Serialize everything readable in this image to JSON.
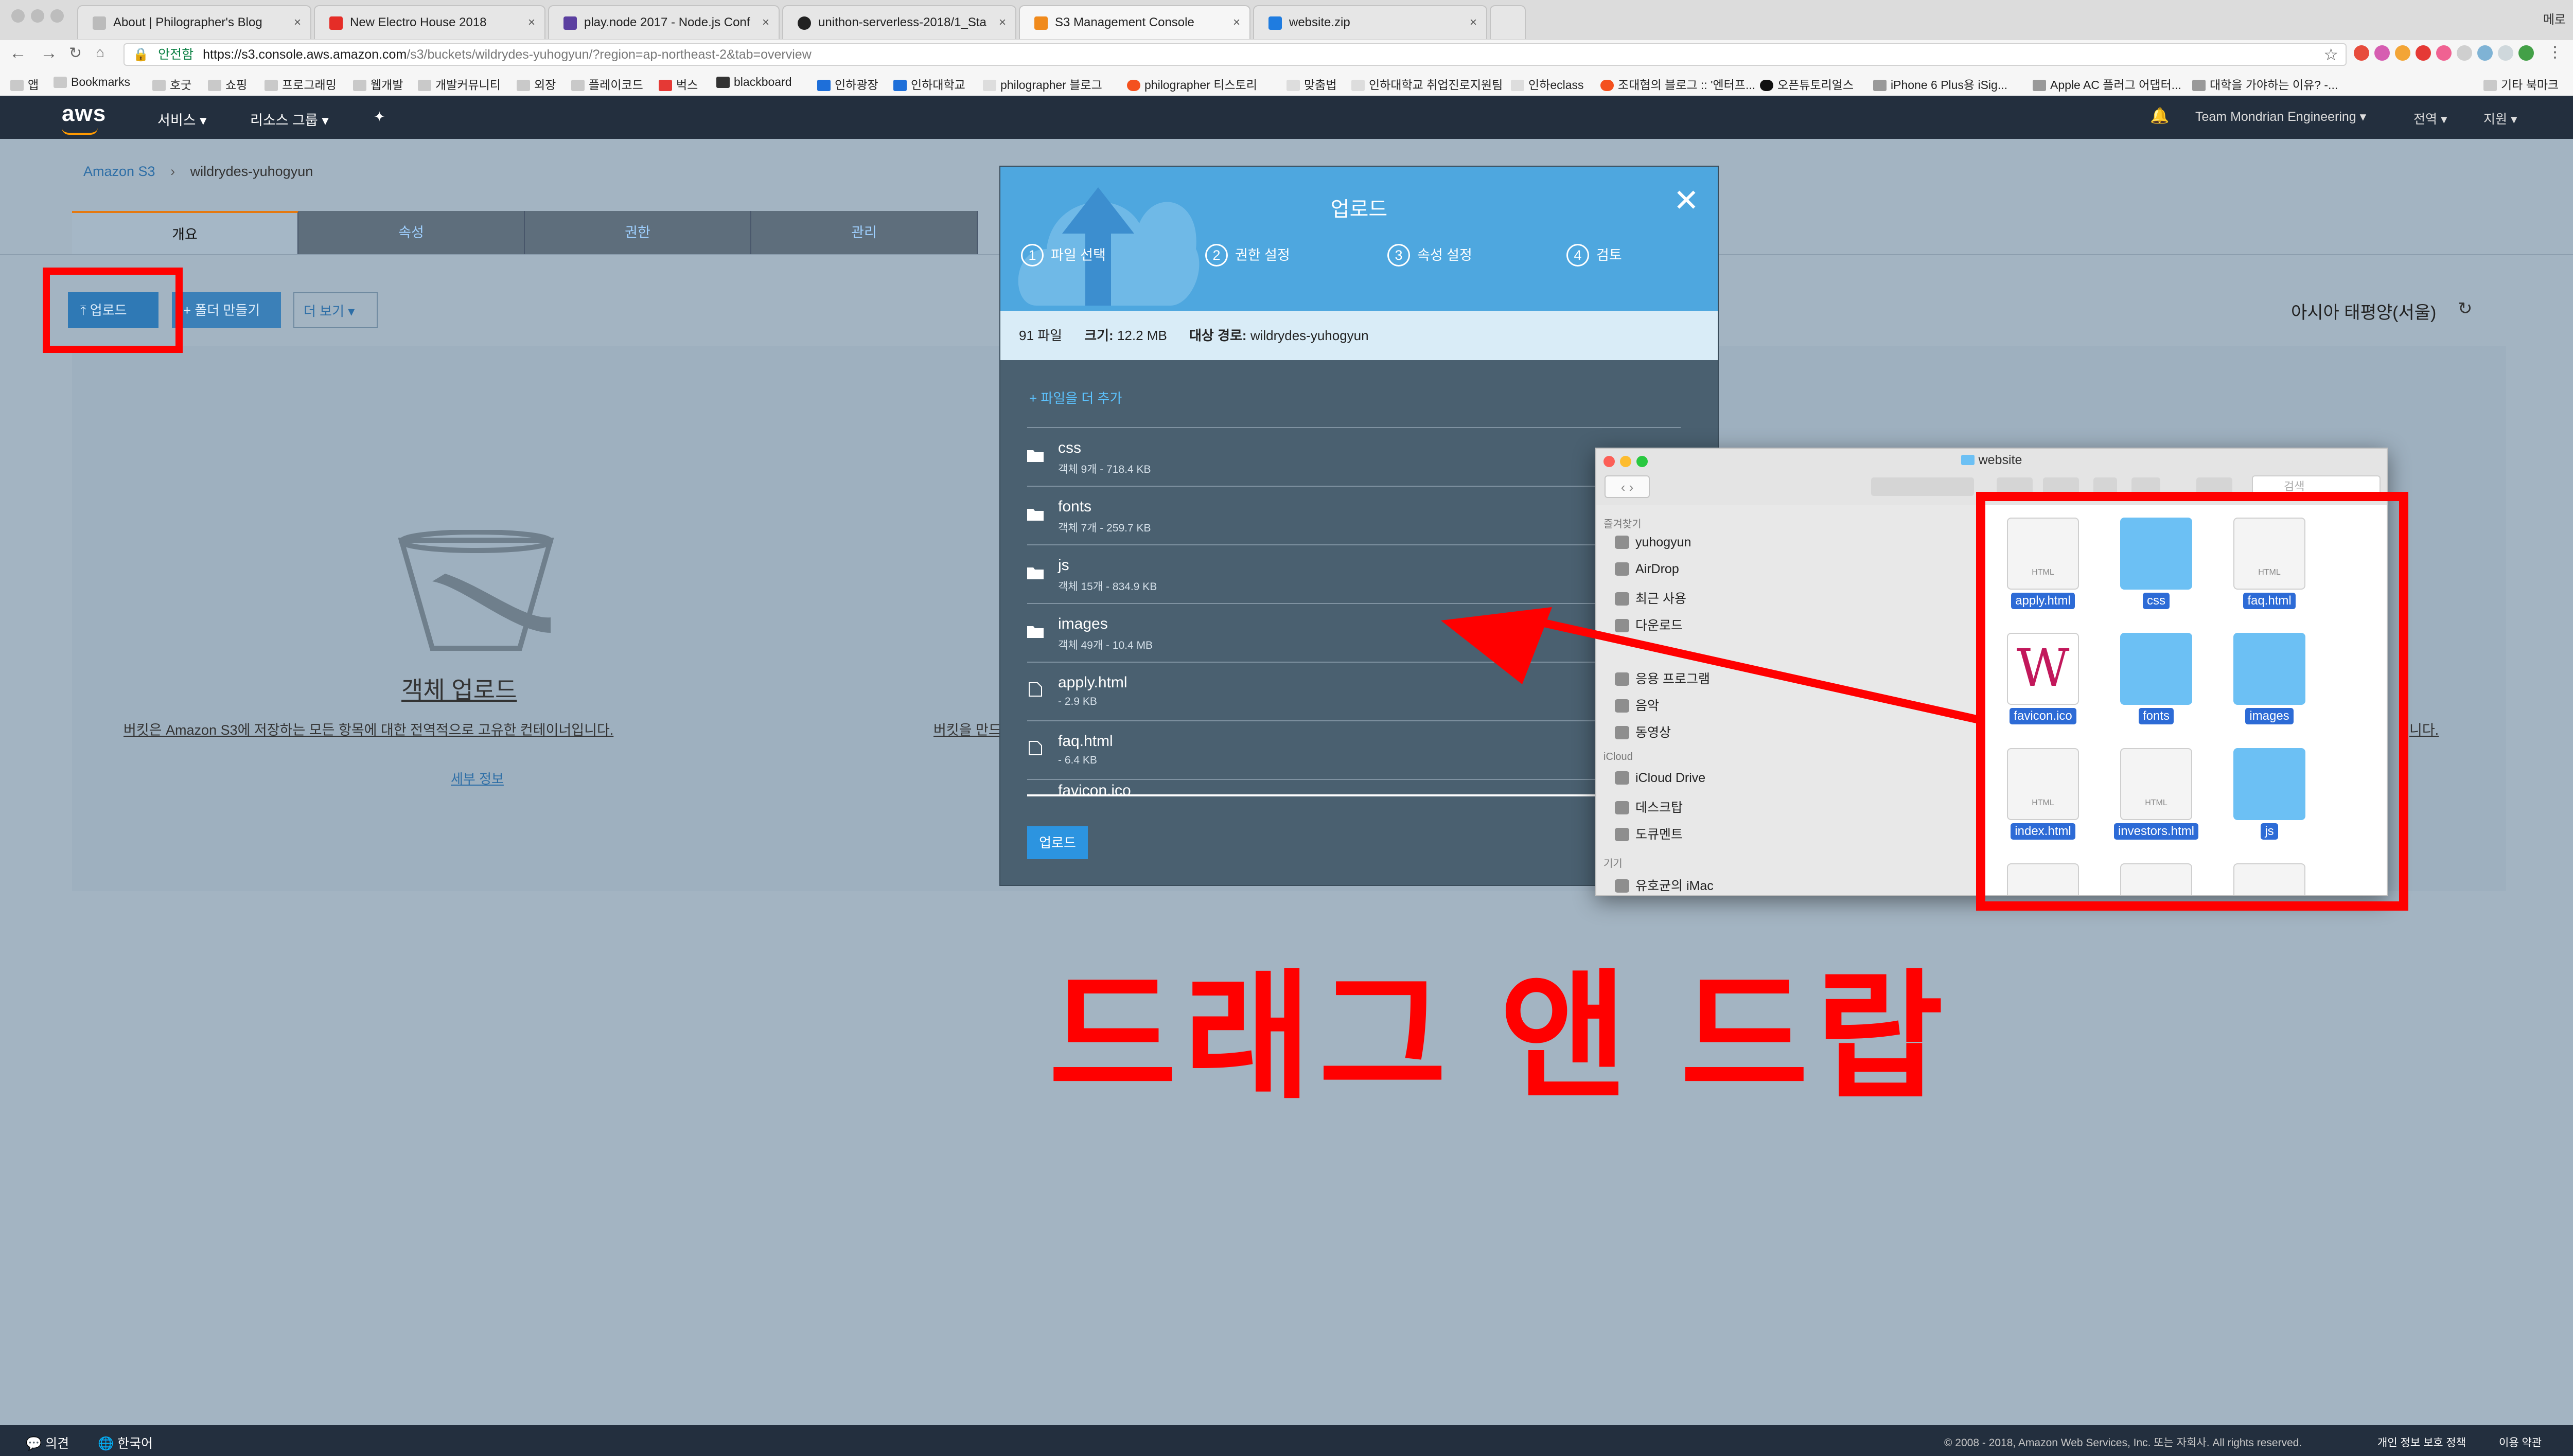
{
  "browser": {
    "tabs": [
      {
        "title": "About | Philographer's Blog"
      },
      {
        "title": "New Electro House 2018"
      },
      {
        "title": "play.node 2017 - Node.js Conf"
      },
      {
        "title": "unithon-serverless-2018/1_Sta"
      },
      {
        "title": "S3 Management Console"
      },
      {
        "title": "website.zip"
      }
    ],
    "profile_label": "메로",
    "secure_label": "안전함",
    "url_host": "https://s3.console.aws.amazon.com",
    "url_path": "/s3/buckets/wildrydes-yuhogyun/?region=ap-northeast-2&tab=overview",
    "bookmarks": [
      "앱",
      "Bookmarks",
      "호굿",
      "쇼핑",
      "프로그래밍",
      "웹개발",
      "개발커뮤니티",
      "외장",
      "플레이코드",
      "벅스",
      "blackboard",
      "인하광장",
      "인하대학교",
      "philographer 블로그",
      "philographer 티스토리",
      "맞춤법",
      "인하대학교 취업진로지원팀",
      "인하eclass",
      "조대협의 블로그 :: '엔터프...",
      "오픈튜토리얼스",
      "iPhone 6 Plus용 iSig...",
      "Apple AC 플러그 어댑터...",
      "대학을 가야하는 이유? -..."
    ],
    "other_bookmarks": "기타 북마크"
  },
  "aws": {
    "logo": "aws",
    "services": "서비스",
    "resource_groups": "리소스 그룹",
    "account": "Team Mondrian Engineering",
    "region_menu": "전역",
    "support_menu": "지원"
  },
  "page": {
    "breadcrumb_root": "Amazon S3",
    "breadcrumb_bucket": "wildrydes-yuhogyun",
    "tabs": [
      "개요",
      "속성",
      "권한",
      "관리"
    ],
    "upload_btn": "업로드",
    "new_folder_btn": "폴더 만들기",
    "more_btn": "더 보기",
    "region_label": "아시아 태평양(서울)",
    "empty_title": "객체 업로드",
    "empty_desc": "버킷은 Amazon S3에 저장하는 모든 항목에 대한 전역적으로 고유한 컨테이너입니다.",
    "empty_desc_right_fragment": "버킷을 만드",
    "learn_more": "세부 정보"
  },
  "modal": {
    "title": "업로드",
    "steps": [
      {
        "num": "1",
        "label": "파일 선택"
      },
      {
        "num": "2",
        "label": "권한 설정"
      },
      {
        "num": "3",
        "label": "속성 설정"
      },
      {
        "num": "4",
        "label": "검토"
      }
    ],
    "files_count": "91 파일",
    "size_label": "크기:",
    "size_value": "12.2 MB",
    "dest_label": "대상 경로:",
    "dest_value": "wildrydes-yuhogyun",
    "add_more": "+ 파일을 더 추가",
    "files": [
      {
        "name": "css",
        "meta": "객체 9개 - 718.4 KB",
        "kind": "folder"
      },
      {
        "name": "fonts",
        "meta": "객체 7개 - 259.7 KB",
        "kind": "folder"
      },
      {
        "name": "js",
        "meta": "객체 15개 - 834.9 KB",
        "kind": "folder"
      },
      {
        "name": "images",
        "meta": "객체 49개 - 10.4 MB",
        "kind": "folder"
      },
      {
        "name": "apply.html",
        "meta": "- 2.9 KB",
        "kind": "file"
      },
      {
        "name": "faq.html",
        "meta": "- 6.4 KB",
        "kind": "file"
      },
      {
        "name": "favicon.ico",
        "meta": "",
        "kind": "file"
      }
    ],
    "upload_btn": "업로드"
  },
  "finder": {
    "title": "website",
    "search_placeholder": "검색",
    "favorites_header": "즐겨찾기",
    "favorites": [
      "yuhogyun",
      "AirDrop",
      "최근 사용",
      "다운로드",
      "응용 프로그램",
      "음악",
      "동영상"
    ],
    "icloud_header": "iCloud",
    "icloud": [
      "iCloud Drive",
      "데스크탑",
      "도큐멘트"
    ],
    "devices_header": "기기",
    "devices": [
      "유호균의 iMac"
    ],
    "items": [
      {
        "name": "apply.html",
        "kind": "doc"
      },
      {
        "name": "css",
        "kind": "folder"
      },
      {
        "name": "faq.html",
        "kind": "doc"
      },
      {
        "name": "favicon.ico",
        "kind": "favicon"
      },
      {
        "name": "fonts",
        "kind": "folder"
      },
      {
        "name": "images",
        "kind": "folder"
      },
      {
        "name": "index.html",
        "kind": "doc"
      },
      {
        "name": "investors.html",
        "kind": "doc"
      },
      {
        "name": "js",
        "kind": "folder"
      }
    ],
    "doc_badge": "HTML",
    "favicon_glyph": "W"
  },
  "annotation": {
    "drag_text": "드래그 앤 드랍",
    "color": "#ff0000"
  },
  "footer": {
    "feedback": "의견",
    "language": "한국어",
    "copyright": "© 2008 - 2018, Amazon Web Services, Inc. 또는 자회사. All rights reserved.",
    "privacy": "개인 정보 보호 정책",
    "terms": "이용 약관"
  }
}
